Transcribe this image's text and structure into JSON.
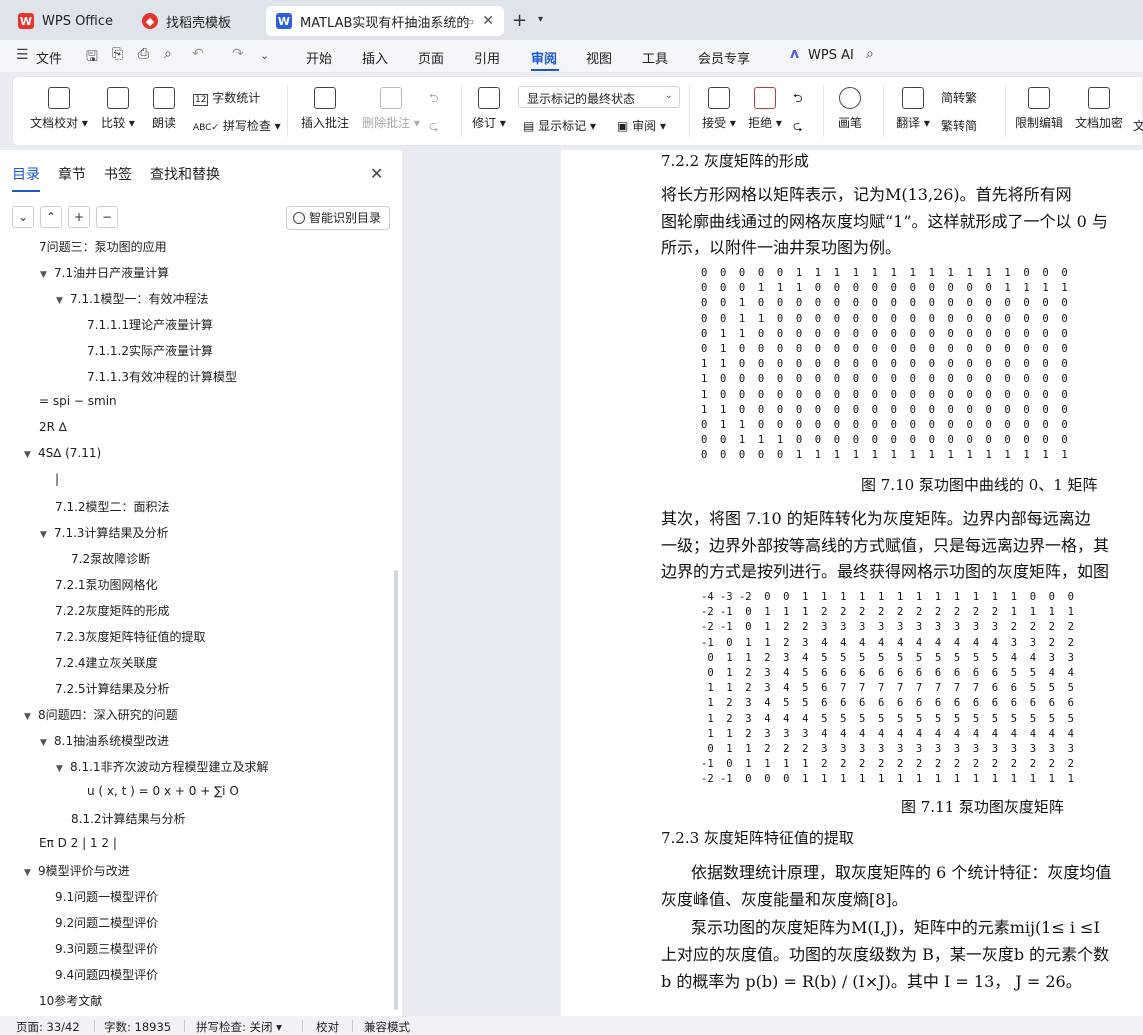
{
  "tabs": [
    {
      "label": "WPS Office"
    },
    {
      "label": "找稻壳模板"
    },
    {
      "label": "MATLAB实现有杆抽油系统的"
    }
  ],
  "menubar": {
    "file": "文件",
    "items": [
      "开始",
      "插入",
      "页面",
      "引用",
      "审阅",
      "视图",
      "工具",
      "会员专享"
    ],
    "active": "审阅",
    "ai": "WPS AI"
  },
  "ribbon": {
    "doc_proofread": "文档校对",
    "compare": "比较",
    "read_aloud": "朗读",
    "word_count": "字数统计",
    "spell_check": "拼写检查",
    "insert_comment": "插入批注",
    "delete_comment": "删除批注",
    "track_changes": "修订",
    "markup_state": "显示标记的最终状态",
    "show_markup": "显示标记",
    "review": "审阅",
    "accept": "接受",
    "reject": "拒绝",
    "pen": "画笔",
    "translate": "翻译",
    "to_traditional": "简转繁",
    "to_simplified": "繁转简",
    "restrict_edit": "限制编辑",
    "doc_encrypt": "文档加密",
    "more": "文"
  },
  "sidebar": {
    "tabs": [
      "目录",
      "章节",
      "书签",
      "查找和替换"
    ],
    "smart_toc": "智能识别目录",
    "toc": [
      {
        "text": "7问题三：泵功图的应用",
        "level": 1,
        "arrow": ""
      },
      {
        "text": "7.1油井日产液量计算",
        "level": 2,
        "arrow": "▼"
      },
      {
        "text": "7.1.1模型一：有效冲程法",
        "level": 3,
        "arrow": "▼"
      },
      {
        "text": "7.1.1.1理论产液量计算",
        "level": 4,
        "arrow": ""
      },
      {
        "text": "7.1.1.2实际产液量计算",
        "level": 4,
        "arrow": ""
      },
      {
        "text": "7.1.1.3有效冲程的计算模型",
        "level": 4,
        "arrow": ""
      },
      {
        "text": "= spi − smin",
        "level": 1,
        "arrow": ""
      },
      {
        "text": "2R ∆",
        "level": 1,
        "arrow": ""
      },
      {
        "text": "4S∆ (7.11)",
        "level": 1,
        "arrow": "▼"
      },
      {
        "text": "|",
        "level": 2,
        "arrow": ""
      },
      {
        "text": "7.1.2模型二：面积法",
        "level": 2,
        "arrow": ""
      },
      {
        "text": "7.1.3计算结果及分析",
        "level": 2,
        "arrow": "▼"
      },
      {
        "text": "7.2泵故障诊断",
        "level": 3,
        "arrow": ""
      },
      {
        "text": "7.2.1泵功图网格化",
        "level": 2,
        "arrow": ""
      },
      {
        "text": "7.2.2灰度矩阵的形成",
        "level": 2,
        "arrow": ""
      },
      {
        "text": "7.2.3灰度矩阵特征值的提取",
        "level": 2,
        "arrow": ""
      },
      {
        "text": "7.2.4建立灰关联度",
        "level": 2,
        "arrow": ""
      },
      {
        "text": "7.2.5计算结果及分析",
        "level": 2,
        "arrow": ""
      },
      {
        "text": "8问题四：深入研究的问题",
        "level": 1,
        "arrow": "▼"
      },
      {
        "text": "8.1抽油系统模型改进",
        "level": 2,
        "arrow": "▼"
      },
      {
        "text": "8.1.1非齐次波动方程模型建立及求解",
        "level": 3,
        "arrow": "▼"
      },
      {
        "text": "u ( x, t ) =    0 x + 0 + ∑i O",
        "level": 4,
        "arrow": ""
      },
      {
        "text": "8.1.2计算结果与分析",
        "level": 3,
        "arrow": ""
      },
      {
        "text": "Eπ D 2 |   1 2  |",
        "level": 1,
        "arrow": ""
      },
      {
        "text": "9模型评价与改进",
        "level": 1,
        "arrow": "▼"
      },
      {
        "text": "9.1问题一模型评价",
        "level": 2,
        "arrow": ""
      },
      {
        "text": "9.2问题二模型评价",
        "level": 2,
        "arrow": ""
      },
      {
        "text": "9.3问题三模型评价",
        "level": 2,
        "arrow": ""
      },
      {
        "text": "9.4问题四模型评价",
        "level": 2,
        "arrow": ""
      },
      {
        "text": "10参考文献",
        "level": 1,
        "arrow": ""
      }
    ]
  },
  "document": {
    "heading1": "7.2.2  灰度矩阵的形成",
    "para1": [
      "将长方形网格以矩阵表示，记为M(13,26)。首先将所有网",
      "图轮廓曲线通过的网格灰度均赋“1”。这样就形成了一个以 0 与",
      "所示，以附件一油井泵功图为例。"
    ],
    "matrix1": [
      "0  0  0  0  0  1  1  1  1  1  1  1  1  1  1  1  1  0  0  0",
      "0  0  0  1  1  1  0  0  0  0  0  0  0  0  0  0  1  1  1  1",
      "0  0  1  0  0  0  0  0  0  0  0  0  0  0  0  0  0  0  0  0",
      "0  0  1  1  0  0  0  0  0  0  0  0  0  0  0  0  0  0  0  0",
      "0  1  1  0  0  0  0  0  0  0  0  0  0  0  0  0  0  0  0  0",
      "0  1  0  0  0  0  0  0  0  0  0  0  0  0  0  0  0  0  0  0",
      "1  1  0  0  0  0  0  0  0  0  0  0  0  0  0  0  0  0  0  0",
      "1  0  0  0  0  0  0  0  0  0  0  0  0  0  0  0  0  0  0  0",
      "1  0  0  0  0  0  0  0  0  0  0  0  0  0  0  0  0  0  0  0",
      "1  1  0  0  0  0  0  0  0  0  0  0  0  0  0  0  0  0  0  0",
      "0  1  1  0  0  0  0  0  0  0  0  0  0  0  0  0  0  0  0  0",
      "0  0  1  1  1  0  0  0  0  0  0  0  0  0  0  0  0  0  0  0",
      "0  0  0  0  0  1  1  1  1  1  1  1  1  1  1  1  1  1  1  1"
    ],
    "caption1": "图  7.10 泵功图中曲线的  0、1 矩阵",
    "para2": [
      "其次，将图  7.10 的矩阵转化为灰度矩阵。边界内部每远离边",
      "一级；边界外部按等高线的方式赋值，只是每远离边界一格，其",
      "边界的方式是按列进行。最终获得网格示功图的灰度矩阵，如图"
    ],
    "matrix2": [
      "-4 -3 -2  0  0  1  1  1  1  1  1  1  1  1  1  1  1  0  0  0",
      "-2 -1  0  1  1  1  2  2  2  2  2  2  2  2  2  2  1  1  1  1",
      "-2 -1  0  1  2  2  3  3  3  3  3  3  3  3  3  3  2  2  2  2",
      "-1  0  1  1  2  3  4  4  4  4  4  4  4  4  4  4  3  3  2  2",
      " 0  1  1  2  3  4  5  5  5  5  5  5  5  5  5  5  4  4  3  3",
      " 0  1  2  3  4  5  6  6  6  6  6  6  6  6  6  6  5  5  4  4",
      " 1  1  2  3  4  5  6  7  7  7  7  7  7  7  7  6  6  5  5  5",
      " 1  2  3  4  5  5  6  6  6  6  6  6  6  6  6  6  6  6  6  6",
      " 1  2  3  4  4  4  5  5  5  5  5  5  5  5  5  5  5  5  5  5",
      " 1  1  2  3  3  3  4  4  4  4  4  4  4  4  4  4  4  4  4  4",
      " 0  1  1  2  2  2  3  3  3  3  3  3  3  3  3  3  3  3  3  3",
      "-1  0  1  1  1  1  2  2  2  2  2  2  2  2  2  2  2  2  2  2",
      "-2 -1  0  0  0  1  1  1  1  1  1  1  1  1  1  1  1  1  1  1"
    ],
    "caption2": "图  7.11 泵功图灰度矩阵",
    "heading2": "7.2.3   灰度矩阵特征值的提取",
    "para3": [
      "依据数理统计原理，取灰度矩阵的  6 个统计特征：灰度均值",
      "灰度峰值、灰度能量和灰度熵[8]。",
      "泵示功图的灰度矩阵为M(I,J)，矩阵中的元素mij(1≤ i ≤I",
      "上对应的灰度值。功图的灰度级数为 B，某一灰度b 的元素个数",
      "b 的概率为 p(b) = R(b) / (I×J)。其中 I = 13，  J = 26。"
    ]
  },
  "statusbar": {
    "page": "页面: 33/42",
    "words": "字数: 18935",
    "spell": "拼写检查: 关闭",
    "proofread": "校对",
    "compat": "兼容模式"
  }
}
